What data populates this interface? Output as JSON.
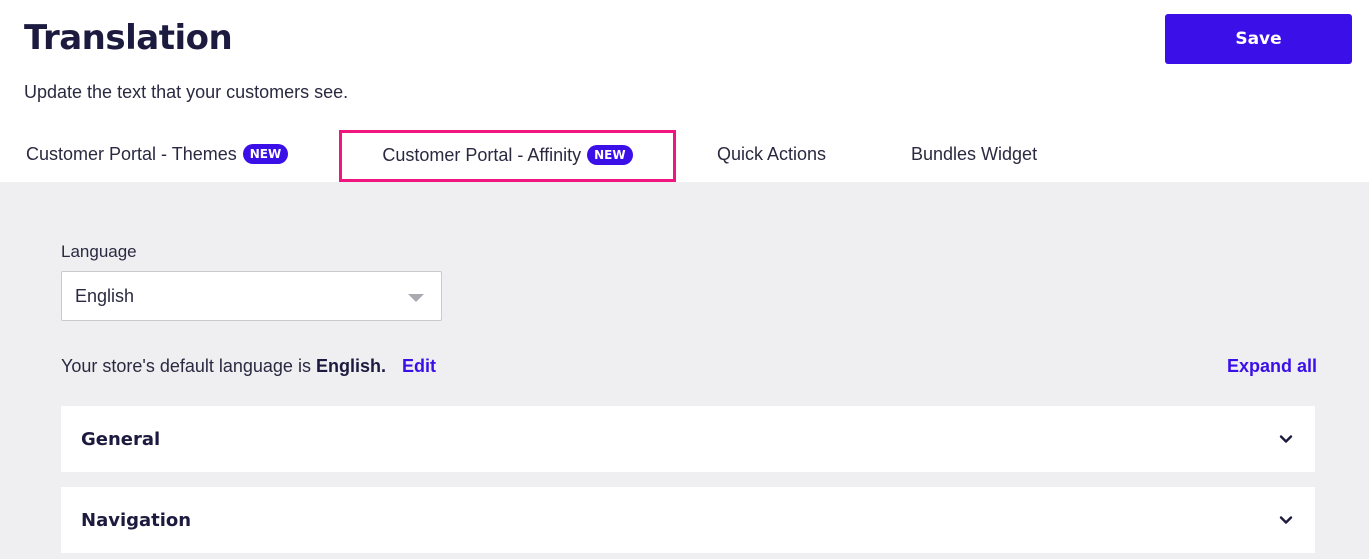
{
  "header": {
    "title": "Translation",
    "subtitle": "Update the text that your customers see.",
    "save_label": "Save"
  },
  "tabs": [
    {
      "label": "Customer Portal - Themes",
      "badge": "NEW"
    },
    {
      "label": "Customer Portal - Affinity",
      "badge": "NEW",
      "highlighted": true
    },
    {
      "label": "Quick Actions"
    },
    {
      "label": "Bundles Widget"
    }
  ],
  "language": {
    "label": "Language",
    "selected": "English"
  },
  "default_language": {
    "text": "Your store's default language is",
    "value": "English.",
    "edit_label": "Edit"
  },
  "expand_all_label": "Expand all",
  "sections": [
    {
      "title": "General",
      "icon": "chevron-down-icon"
    },
    {
      "title": "Navigation",
      "icon": "chevron-down-icon"
    }
  ],
  "colors": {
    "accent": "#3b0fe8",
    "highlight": "#f0157f",
    "content_bg": "#efeff1"
  }
}
